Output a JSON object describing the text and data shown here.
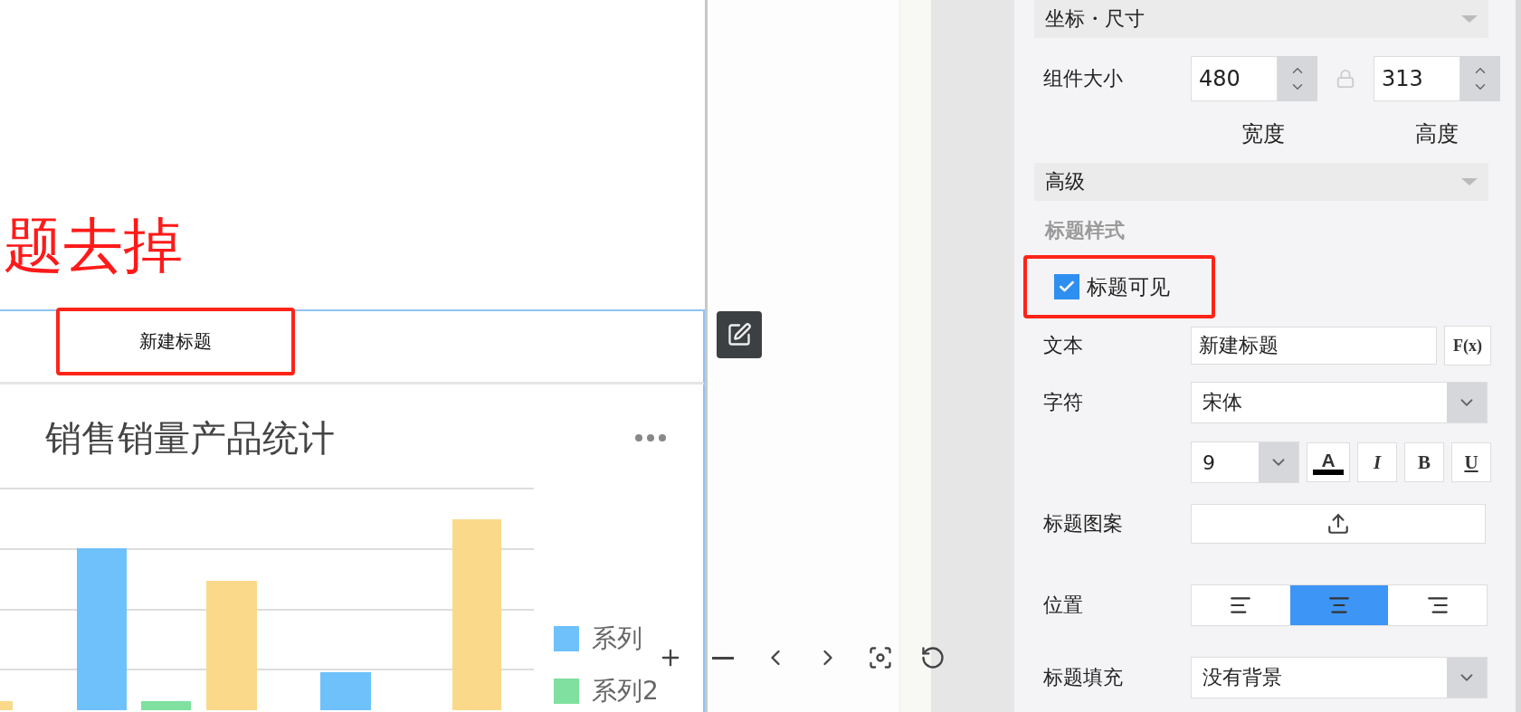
{
  "canvas": {
    "annotation": "题去掉",
    "title_widget": {
      "text": "新建标题",
      "highlighted": true
    },
    "chart": {
      "title": "销售销量产品统计",
      "legend": [
        {
          "label": "系列",
          "color": "#6ec1fb"
        },
        {
          "label": "系列2",
          "color": "#7fe0a0"
        }
      ]
    }
  },
  "panel": {
    "position_size": {
      "header": "坐标・尺寸",
      "size_label": "组件大小",
      "width": {
        "value": "480",
        "label": "宽度"
      },
      "height": {
        "value": "313",
        "label": "高度"
      }
    },
    "advanced": {
      "header": "高级",
      "group_label": "标题样式",
      "title_visible": {
        "label": "标题可见",
        "checked": true,
        "highlighted": true
      },
      "text": {
        "label": "文本",
        "value": "新建标题",
        "formula_button": "F(x)"
      },
      "font": {
        "label": "字符",
        "value": "宋体"
      },
      "font_size": "9",
      "format_buttons": [
        {
          "kind": "color",
          "label": "A"
        },
        {
          "kind": "italic",
          "label": "I"
        },
        {
          "kind": "bold",
          "label": "B"
        },
        {
          "kind": "underline",
          "label": "U"
        }
      ],
      "image": {
        "label": "标题图案"
      },
      "position": {
        "label": "位置",
        "options": [
          {
            "kind": "left",
            "selected": false
          },
          {
            "kind": "center",
            "selected": true
          },
          {
            "kind": "right",
            "selected": false
          }
        ]
      },
      "fill": {
        "label": "标题填充",
        "value": "没有背景"
      }
    }
  }
}
